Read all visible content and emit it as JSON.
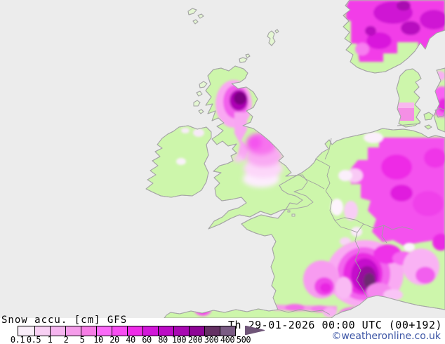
{
  "title": {
    "product": "Snow accu. [cm] GFS",
    "datetime": "Th 29-01-2026 00:00 UTC (00+192)",
    "copyright": "©weatheronline.co.uk"
  },
  "legend": {
    "unit": "cm",
    "tick_labels": [
      "0.1",
      "0.5",
      "1",
      "2",
      "5",
      "10",
      "20",
      "40",
      "60",
      "80",
      "100",
      "200",
      "300",
      "400",
      "500"
    ],
    "segment_colors": [
      "#f9eef9",
      "#f8d0f4",
      "#f5b5ef",
      "#f59cea",
      "#f67de5",
      "#fa6af7",
      "#f74df1",
      "#ee2ce8",
      "#d217d9",
      "#bc0cc6",
      "#a808b2",
      "#8e0496",
      "#643063",
      "#7a5c84"
    ],
    "arrow_color": "#6f5578"
  },
  "map": {
    "model": "GFS",
    "sea_color": "#ececec",
    "land_color": "#cdf6ab",
    "coast_color": "#a6a6a6",
    "snow_light_color": "#f9eef9",
    "snow_heavy_color": "#6d2a71"
  }
}
